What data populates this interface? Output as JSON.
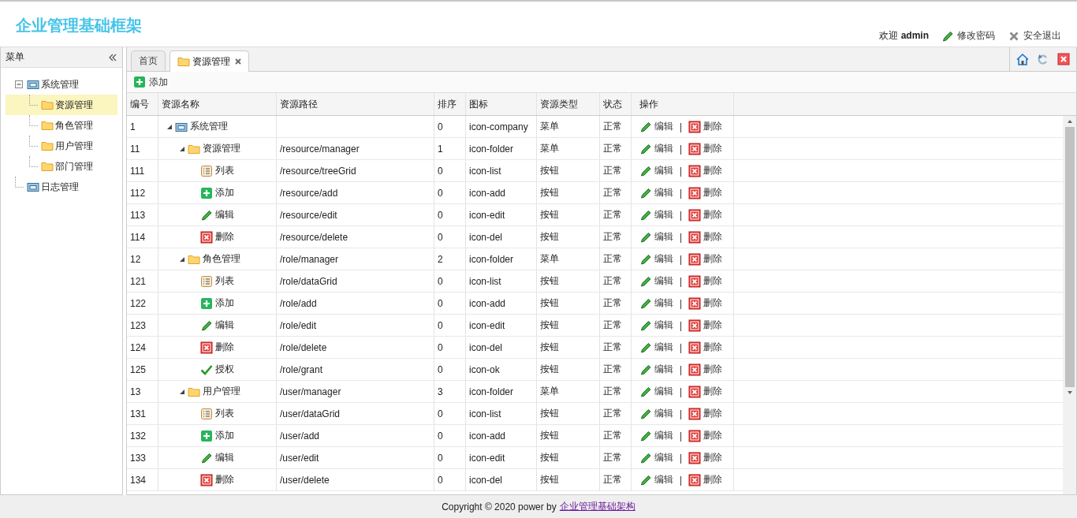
{
  "header": {
    "title": "企业管理基础框架",
    "welcome": "欢迎",
    "user": "admin",
    "links": [
      {
        "kind": "edit",
        "label": "修改密码"
      },
      {
        "kind": "close",
        "label": "安全退出"
      }
    ]
  },
  "sidebar": {
    "title": "菜单",
    "tree": [
      {
        "label": "系统管理",
        "kind": "company",
        "expanded": true,
        "selected": false,
        "children": [
          {
            "label": "资源管理",
            "kind": "folder",
            "selected": true
          },
          {
            "label": "角色管理",
            "kind": "folder",
            "selected": false
          },
          {
            "label": "用户管理",
            "kind": "folder",
            "selected": false
          },
          {
            "label": "部门管理",
            "kind": "folder",
            "selected": false
          }
        ]
      },
      {
        "label": "日志管理",
        "kind": "company",
        "selected": false
      }
    ]
  },
  "tabs": [
    {
      "label": "首页",
      "selected": false
    },
    {
      "label": "资源管理",
      "kind": "folder",
      "selected": true,
      "closable": true
    }
  ],
  "toolbar": [
    {
      "kind": "add",
      "label": "添加"
    }
  ],
  "table": {
    "columns": [
      "编号",
      "资源名称",
      "资源路径",
      "排序",
      "图标",
      "资源类型",
      "状态",
      "操作"
    ],
    "rows": [
      {
        "id": "1",
        "name": "系统管理",
        "kind": "company",
        "expanded": true,
        "order": "0",
        "icon": "icon-company",
        "type": "菜单",
        "status": "正常",
        "actions": [
          {
            "kind": "edit",
            "label": "编辑"
          },
          {
            "kind": "sep",
            "label": "|"
          },
          {
            "kind": "del",
            "label": "删除"
          }
        ],
        "children": [
          {
            "id": "11",
            "name": "资源管理",
            "kind": "folder",
            "expanded": true,
            "path": "/resource/manager",
            "order": "1",
            "icon": "icon-folder",
            "type": "菜单",
            "status": "正常",
            "actions": [
              {
                "kind": "edit",
                "label": "编辑"
              },
              {
                "kind": "sep",
                "label": "|"
              },
              {
                "kind": "del",
                "label": "删除"
              }
            ],
            "children": [
              {
                "id": "111",
                "name": "列表",
                "kind": "list",
                "path": "/resource/treeGrid",
                "order": "0",
                "icon": "icon-list",
                "type": "按钮",
                "status": "正常",
                "actions": [
                  {
                    "kind": "edit",
                    "label": "编辑"
                  },
                  {
                    "kind": "sep",
                    "label": "|"
                  },
                  {
                    "kind": "del",
                    "label": "删除"
                  }
                ]
              },
              {
                "id": "112",
                "name": "添加",
                "kind": "add",
                "path": "/resource/add",
                "order": "0",
                "icon": "icon-add",
                "type": "按钮",
                "status": "正常",
                "actions": [
                  {
                    "kind": "edit",
                    "label": "编辑"
                  },
                  {
                    "kind": "sep",
                    "label": "|"
                  },
                  {
                    "kind": "del",
                    "label": "删除"
                  }
                ]
              },
              {
                "id": "113",
                "name": "编辑",
                "kind": "edit",
                "path": "/resource/edit",
                "order": "0",
                "icon": "icon-edit",
                "type": "按钮",
                "status": "正常",
                "actions": [
                  {
                    "kind": "edit",
                    "label": "编辑"
                  },
                  {
                    "kind": "sep",
                    "label": "|"
                  },
                  {
                    "kind": "del",
                    "label": "删除"
                  }
                ]
              },
              {
                "id": "114",
                "name": "删除",
                "kind": "del",
                "path": "/resource/delete",
                "order": "0",
                "icon": "icon-del",
                "type": "按钮",
                "status": "正常",
                "actions": [
                  {
                    "kind": "edit",
                    "label": "编辑"
                  },
                  {
                    "kind": "sep",
                    "label": "|"
                  },
                  {
                    "kind": "del",
                    "label": "删除"
                  }
                ]
              }
            ]
          },
          {
            "id": "12",
            "name": "角色管理",
            "kind": "folder",
            "expanded": true,
            "path": "/role/manager",
            "order": "2",
            "icon": "icon-folder",
            "type": "菜单",
            "status": "正常",
            "actions": [
              {
                "kind": "edit",
                "label": "编辑"
              },
              {
                "kind": "sep",
                "label": "|"
              },
              {
                "kind": "del",
                "label": "删除"
              }
            ],
            "children": [
              {
                "id": "121",
                "name": "列表",
                "kind": "list",
                "path": "/role/dataGrid",
                "order": "0",
                "icon": "icon-list",
                "type": "按钮",
                "status": "正常",
                "actions": [
                  {
                    "kind": "edit",
                    "label": "编辑"
                  },
                  {
                    "kind": "sep",
                    "label": "|"
                  },
                  {
                    "kind": "del",
                    "label": "删除"
                  }
                ]
              },
              {
                "id": "122",
                "name": "添加",
                "kind": "add",
                "path": "/role/add",
                "order": "0",
                "icon": "icon-add",
                "type": "按钮",
                "status": "正常",
                "actions": [
                  {
                    "kind": "edit",
                    "label": "编辑"
                  },
                  {
                    "kind": "sep",
                    "label": "|"
                  },
                  {
                    "kind": "del",
                    "label": "删除"
                  }
                ]
              },
              {
                "id": "123",
                "name": "编辑",
                "kind": "edit",
                "path": "/role/edit",
                "order": "0",
                "icon": "icon-edit",
                "type": "按钮",
                "status": "正常",
                "actions": [
                  {
                    "kind": "edit",
                    "label": "编辑"
                  },
                  {
                    "kind": "sep",
                    "label": "|"
                  },
                  {
                    "kind": "del",
                    "label": "删除"
                  }
                ]
              },
              {
                "id": "124",
                "name": "删除",
                "kind": "del",
                "path": "/role/delete",
                "order": "0",
                "icon": "icon-del",
                "type": "按钮",
                "status": "正常",
                "actions": [
                  {
                    "kind": "edit",
                    "label": "编辑"
                  },
                  {
                    "kind": "sep",
                    "label": "|"
                  },
                  {
                    "kind": "del",
                    "label": "删除"
                  }
                ]
              },
              {
                "id": "125",
                "name": "授权",
                "kind": "ok",
                "path": "/role/grant",
                "order": "0",
                "icon": "icon-ok",
                "type": "按钮",
                "status": "正常",
                "actions": [
                  {
                    "kind": "edit",
                    "label": "编辑"
                  },
                  {
                    "kind": "sep",
                    "label": "|"
                  },
                  {
                    "kind": "del",
                    "label": "删除"
                  }
                ]
              }
            ]
          },
          {
            "id": "13",
            "name": "用户管理",
            "kind": "folder",
            "expanded": true,
            "path": "/user/manager",
            "order": "3",
            "icon": "icon-folder",
            "type": "菜单",
            "status": "正常",
            "actions": [
              {
                "kind": "edit",
                "label": "编辑"
              },
              {
                "kind": "sep",
                "label": "|"
              },
              {
                "kind": "del",
                "label": "删除"
              }
            ],
            "children": [
              {
                "id": "131",
                "name": "列表",
                "kind": "list",
                "path": "/user/dataGrid",
                "order": "0",
                "icon": "icon-list",
                "type": "按钮",
                "status": "正常",
                "actions": [
                  {
                    "kind": "edit",
                    "label": "编辑"
                  },
                  {
                    "kind": "sep",
                    "label": "|"
                  },
                  {
                    "kind": "del",
                    "label": "删除"
                  }
                ]
              },
              {
                "id": "132",
                "name": "添加",
                "kind": "add",
                "path": "/user/add",
                "order": "0",
                "icon": "icon-add",
                "type": "按钮",
                "status": "正常",
                "actions": [
                  {
                    "kind": "edit",
                    "label": "编辑"
                  },
                  {
                    "kind": "sep",
                    "label": "|"
                  },
                  {
                    "kind": "del",
                    "label": "删除"
                  }
                ]
              },
              {
                "id": "133",
                "name": "编辑",
                "kind": "edit",
                "path": "/user/edit",
                "order": "0",
                "icon": "icon-edit",
                "type": "按钮",
                "status": "正常",
                "actions": [
                  {
                    "kind": "edit",
                    "label": "编辑"
                  },
                  {
                    "kind": "sep",
                    "label": "|"
                  },
                  {
                    "kind": "del",
                    "label": "删除"
                  }
                ]
              },
              {
                "id": "134",
                "name": "删除",
                "kind": "del",
                "path": "/user/delete",
                "order": "0",
                "icon": "icon-del",
                "type": "按钮",
                "status": "正常",
                "actions": [
                  {
                    "kind": "edit",
                    "label": "编辑"
                  },
                  {
                    "kind": "sep",
                    "label": "|"
                  },
                  {
                    "kind": "del",
                    "label": "删除"
                  }
                ]
              }
            ]
          }
        ]
      }
    ]
  },
  "footer": {
    "text": "Copyright © 2020 power by",
    "link": "企业管理基础架构"
  }
}
